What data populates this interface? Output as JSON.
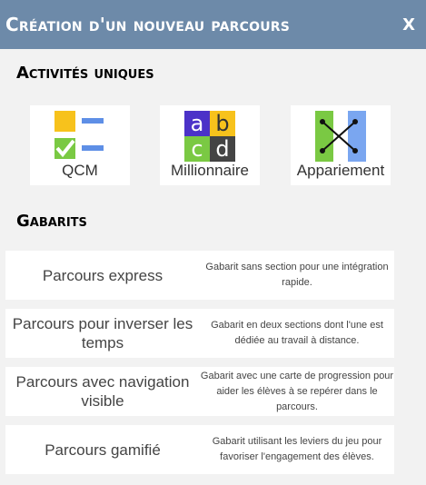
{
  "header": {
    "title": "Création d'un nouveau parcours",
    "close_label": "X"
  },
  "activities": {
    "title": "Activités uniques",
    "items": [
      {
        "label": "QCM",
        "icon": "qcm-icon"
      },
      {
        "label": "Millionnaire",
        "icon": "millionnaire-icon",
        "letters": [
          "a",
          "b",
          "c",
          "d"
        ]
      },
      {
        "label": "Appariement",
        "icon": "appariement-icon"
      }
    ]
  },
  "templates": {
    "title": "Gabarits",
    "items": [
      {
        "title": "Parcours express",
        "description": "Gabarit sans section pour une intégration rapide."
      },
      {
        "title": "Parcours pour inverser les temps",
        "description": "Gabarit en deux sections dont l'une est dédiée au travail à distance."
      },
      {
        "title": "Parcours avec navigation visible",
        "description": "Gabarit avec une carte de progression pour aider les élèves à se repérer dans le parcours."
      },
      {
        "title": "Parcours gamifié",
        "description": "Gabarit utilisant les leviers du jeu pour favoriser l'engagement des élèves."
      }
    ]
  },
  "colors": {
    "header": "#6d8aa9",
    "yellow": "#f7c21c",
    "blue": "#5e8fe6",
    "green": "#7ac943",
    "dark": "#444444",
    "purple": "#4b32c8",
    "light_blue": "#7aa6f0"
  }
}
